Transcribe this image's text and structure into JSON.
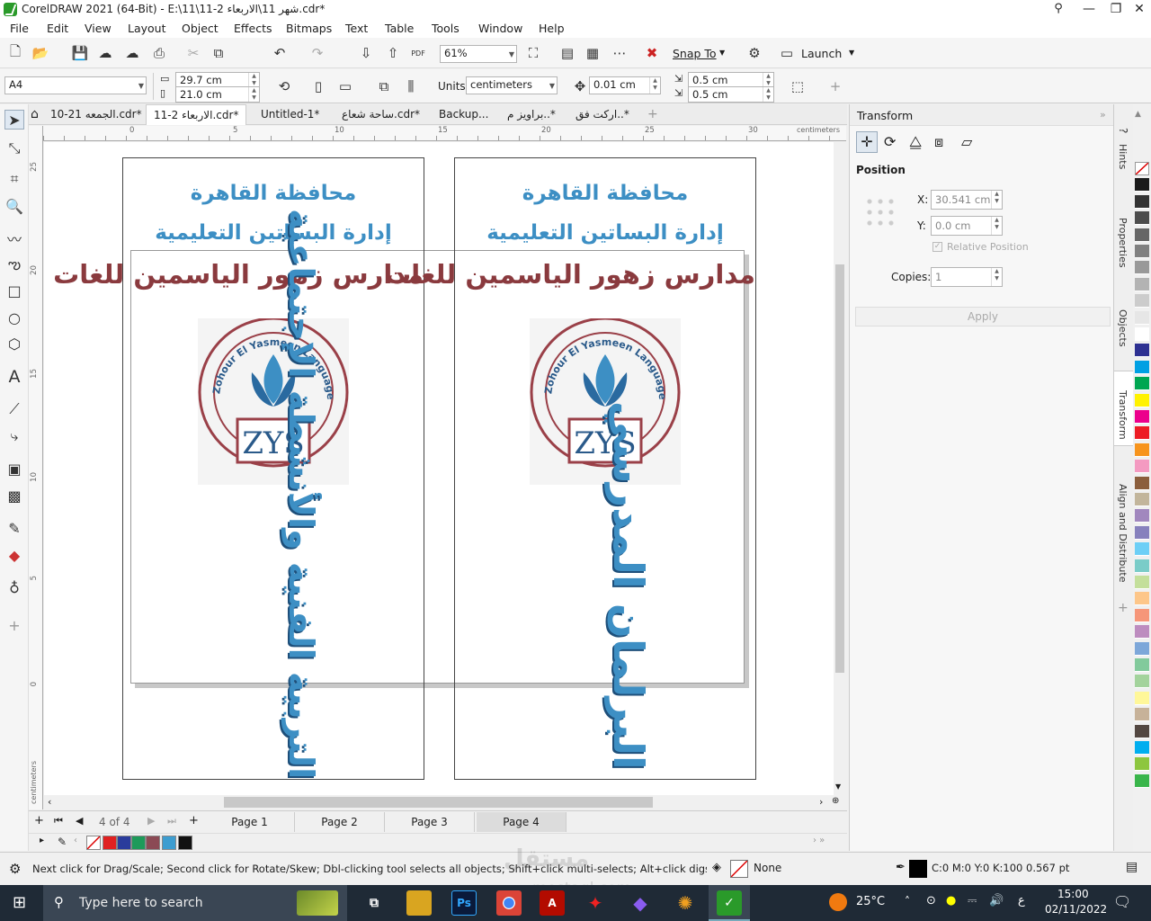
{
  "window": {
    "title": "CorelDRAW 2021 (64-Bit) - E:\\11\\شهر 11\\الاربعاء 2-11.cdr*",
    "minimize": "—",
    "maximize": "❐",
    "close": "✕"
  },
  "menu": [
    "File",
    "Edit",
    "View",
    "Layout",
    "Object",
    "Effects",
    "Bitmaps",
    "Text",
    "Table",
    "Tools",
    "Window",
    "Help"
  ],
  "toolbar1": {
    "zoom": "61%",
    "snap_to": "Snap To",
    "launch": "Launch"
  },
  "toolbar2": {
    "page_size": "A4",
    "width": "29.7 cm",
    "height": "21.0 cm",
    "units_label": "Units:",
    "units": "centimeters",
    "nudge": "0.01 cm",
    "dup_x": "0.5 cm",
    "dup_y": "0.5 cm"
  },
  "doc_tabs": [
    {
      "label": "الجمعه 21-10.cdr*"
    },
    {
      "label": "الاربعاء 2-11.cdr*"
    },
    {
      "label": "Untitled-1*"
    },
    {
      "label": "ساحة شعاع.cdr*"
    },
    {
      "label": "Backup..."
    },
    {
      "label": "براويز م..*"
    },
    {
      "label": "اركت فق..*"
    }
  ],
  "ruler": {
    "h_ticks": [
      "0",
      "5",
      "10",
      "15",
      "20",
      "25",
      "30"
    ],
    "h_unit": "centimeters",
    "v_ticks": [
      "25",
      "20",
      "15",
      "10",
      "5",
      "0"
    ],
    "v_unit": "centimeters"
  },
  "design": {
    "line1": "محافظة القاهرة",
    "line2": "إدارة البساتين التعليمية",
    "line3": "مدارس زهور الياسمين للغات",
    "logo_ring": "Zohour El Yasmeen Language School",
    "logo_letters": "ZYS",
    "left_vertical": "التربية الفنية والأنشطة الإجتماعية",
    "right_vertical": "البرلمان المدرسي"
  },
  "page_nav": {
    "counter": "4 of 4",
    "pages": [
      "Page 1",
      "Page 2",
      "Page 3",
      "Page 4"
    ],
    "active": "Page 4"
  },
  "docker": {
    "title": "Transform",
    "section": "Position",
    "x_label": "X:",
    "x_value": "30.541 cm",
    "y_label": "Y:",
    "y_value": "0.0 cm",
    "relative": "Relative Position",
    "copies_label": "Copies:",
    "copies_value": "1",
    "apply": "Apply"
  },
  "docker_tabs": [
    "Hints",
    "Properties",
    "Objects",
    "Transform",
    "Align and Distribute"
  ],
  "doc_palette": [
    "#e02020",
    "#2a3c9c",
    "#1e9a5a",
    "#8b4a55",
    "#3d9dd0",
    "#111111"
  ],
  "color_palette": [
    "#ffffff",
    "#1a1a1a",
    "#333333",
    "#4d4d4d",
    "#666666",
    "#808080",
    "#999999",
    "#b3b3b3",
    "#cccccc",
    "#e6e6e6",
    "#ffffff",
    "#2e3192",
    "#00a0e3",
    "#00a651",
    "#fff200",
    "#ec008c",
    "#ed1c24",
    "#f7941d",
    "#f49ac1",
    "#8b5e3c",
    "#c2b59b",
    "#a187be",
    "#8781bd",
    "#6dcff6",
    "#7accc8",
    "#c4df9b",
    "#fdc689",
    "#f69679",
    "#bd8cbf",
    "#7da7d9",
    "#82ca9c",
    "#a3d39c",
    "#fff799",
    "#c7b299",
    "#534741",
    "#00aeef",
    "#8dc63f",
    "#39b54a"
  ],
  "status": {
    "hint": "Next click for Drag/Scale; Second click for Rotate/Skew; Dbl-clicking tool selects all objects; Shift+click multi-selects; Alt+click digs",
    "fill": "None",
    "outline": "C:0 M:0 Y:0 K:100  0.567 pt"
  },
  "taskbar": {
    "search_placeholder": "Type here to search",
    "weather": "25°C",
    "lang": "ع",
    "time": "15:00",
    "date": "02/11/2022"
  },
  "watermark": "mostaql.com"
}
